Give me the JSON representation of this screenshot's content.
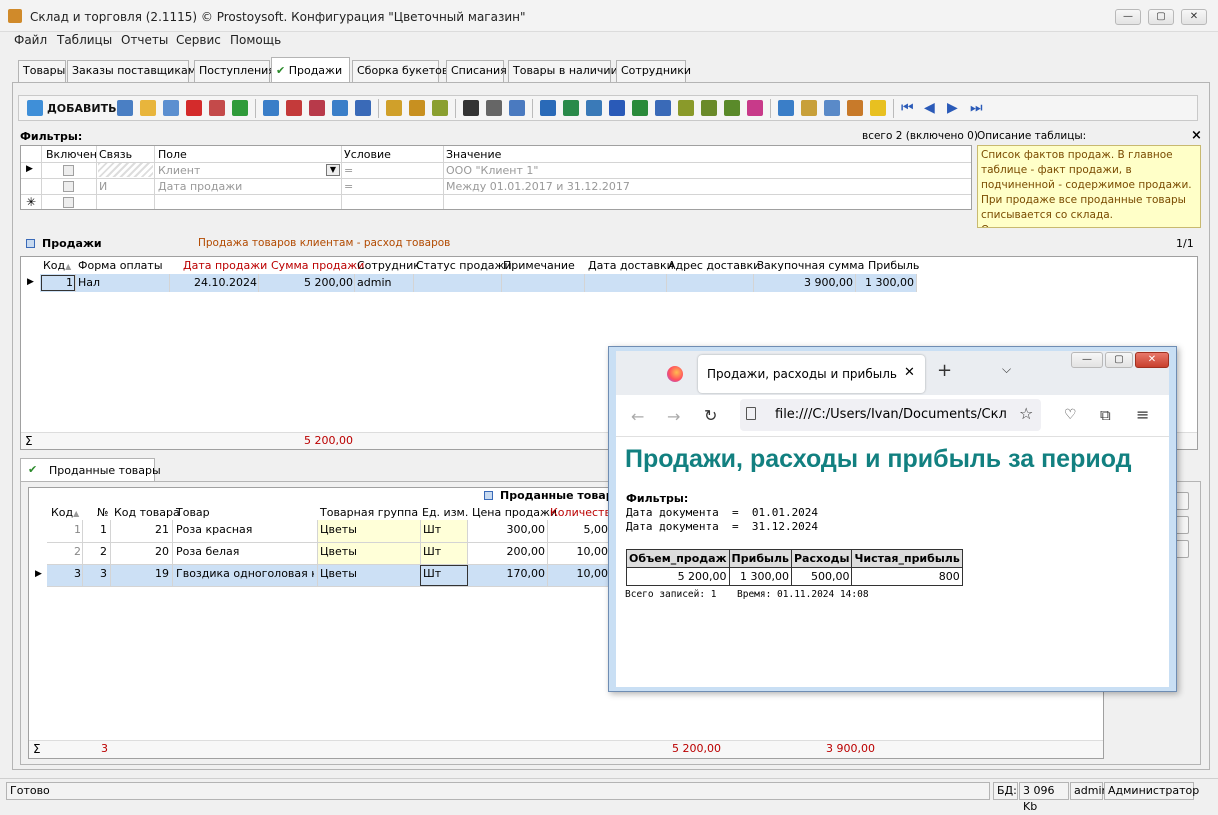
{
  "window": {
    "title": "Склад и торговля (2.1115) © Prostoysoft. Конфигурация \"Цветочный магазин\""
  },
  "menu": [
    "Файл",
    "Таблицы",
    "Отчеты",
    "Сервис",
    "Помощь"
  ],
  "tabs": [
    "Товары",
    "Заказы поставщикам",
    "Поступления",
    "Продажи",
    "Сборка букетов",
    "Списания",
    "Товары в наличии",
    "Сотрудники"
  ],
  "active_tab": "Продажи",
  "toolbar": {
    "add_label": "ДОБАВИТЬ"
  },
  "filters": {
    "title": "Фильтры:",
    "count": "всего 2 (включено 0)",
    "columns": [
      "Включен",
      "Связь",
      "Поле",
      "Условие",
      "Значение"
    ],
    "rows": [
      {
        "link": "",
        "field": "Клиент",
        "condition": "=",
        "value": "ООО \"Клиент 1\""
      },
      {
        "link": "И",
        "field": "Дата продажи",
        "condition": "=",
        "value": "Между 01.01.2017 и 31.12.2017"
      }
    ]
  },
  "description": {
    "title": "Описание таблицы:",
    "close": "×",
    "text": "Список фактов продаж. В главное таблице - факт продажи, в подчиненной - содержимое продажи. При продаже все проданные товары списывается со склада. Отслеживание оплаты может производиться здесь же (розница) или"
  },
  "sales": {
    "title": "Продажи",
    "subtitle": "Продажа товаров клиентам - расход товаров",
    "page": "1/1",
    "columns": [
      "Код",
      "Форма оплаты",
      "Дата продажи",
      "Сумма продажи",
      "Сотрудник",
      "Статус продажи",
      "Примечание",
      "Дата доставки",
      "Адрес доставки",
      "Закупочная сумма",
      "Прибыль"
    ],
    "rows": [
      {
        "code": "1",
        "payment": "Нал",
        "date": "24.10.2024",
        "sum": "5 200,00",
        "employee": "admin",
        "status": "",
        "note": "",
        "delivery_date": "",
        "address": "",
        "purchase_sum": "3 900,00",
        "profit": "1 300,00"
      }
    ],
    "total_sum": "5 200,00",
    "sigma": "Σ"
  },
  "sold": {
    "tab": "Проданные товары",
    "title": "Проданные товары",
    "columns": [
      "Код",
      "№",
      "Код товара",
      "Товар",
      "Товарная группа",
      "Ед. изм.",
      "Цена продажи",
      "Количество"
    ],
    "rows": [
      {
        "code": "1",
        "num": "1",
        "item_code": "21",
        "item": "Роза красная",
        "group": "Цветы",
        "unit": "Шт",
        "price": "300,00",
        "qty": "5,00"
      },
      {
        "code": "2",
        "num": "2",
        "item_code": "20",
        "item": "Роза белая",
        "group": "Цветы",
        "unit": "Шт",
        "price": "200,00",
        "qty": "10,00"
      },
      {
        "code": "3",
        "num": "3",
        "item_code": "19",
        "item": "Гвоздика одноголовая крас",
        "group": "Цветы",
        "unit": "Шт",
        "price": "170,00",
        "qty": "10,00"
      }
    ],
    "total_count": "3",
    "total_sum": "5 200,00",
    "total_purchase": "3 900,00",
    "sigma": "Σ"
  },
  "status": {
    "ready": "Готово",
    "db_label": "БД:",
    "db_size": "3 096 Kb",
    "user": "admin",
    "role": "Администратор"
  },
  "browser": {
    "tab_title": "Продажи, расходы и прибыль за п",
    "url": "file:///C:/Users/Ivan/Documents/Склад",
    "report": {
      "title": "Продажи, расходы и прибыль за период",
      "filters_label": "Фильтры:",
      "filter1": "Дата документа  =  01.01.2024",
      "filter2": "Дата документа  =  31.12.2024",
      "columns": [
        "Объем_продаж",
        "Прибыль",
        "Расходы",
        "Чистая_прибыль"
      ],
      "values": [
        "5 200,00",
        "1 300,00",
        "500,00",
        "800"
      ],
      "footer_records": "Всего записей: 1",
      "footer_time": "Время: 01.11.2024 14:08"
    }
  }
}
